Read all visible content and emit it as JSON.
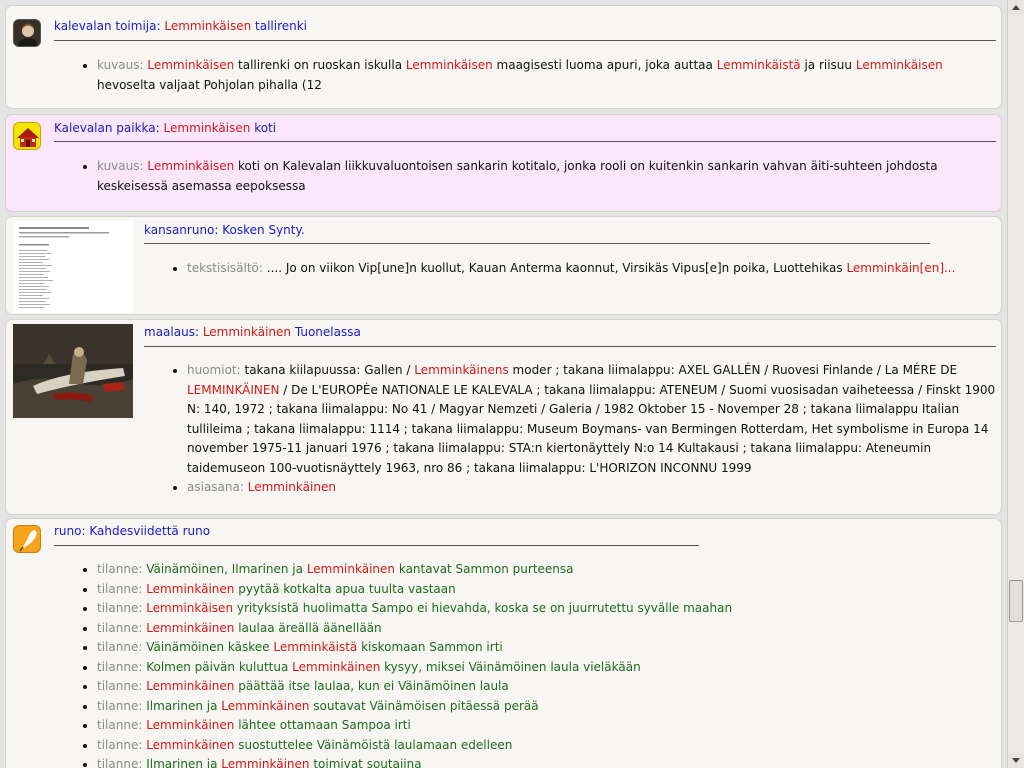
{
  "cards": [
    {
      "type_label": "kalevalan toimija:",
      "title_red": "Lemminkäisen",
      "title_blue": "tallirenki",
      "icon": "person-portrait-icon",
      "desc_label": "kuvaus:",
      "desc": [
        {
          "t": "Lemminkäisen",
          "c": "red"
        },
        {
          "t": " tallirenki on ruoskan iskulla ",
          "c": ""
        },
        {
          "t": "Lemminkäisen",
          "c": "red"
        },
        {
          "t": " maagisesti luoma apuri, joka auttaa ",
          "c": ""
        },
        {
          "t": "Lemminkäistä",
          "c": "red"
        },
        {
          "t": " ja riisuu ",
          "c": ""
        },
        {
          "t": "Lemminkäisen",
          "c": "red"
        },
        {
          "t": " hevoselta valjaat Pohjolan pihalla (12",
          "c": ""
        }
      ]
    },
    {
      "type_label": "Kalevalan paikka:",
      "title_red": "Lemminkäisen",
      "title_blue": "koti",
      "icon": "house-icon",
      "desc_label": "kuvaus:",
      "desc": [
        {
          "t": "Lemminkäisen",
          "c": "red"
        },
        {
          "t": " koti on Kalevalan liikkuvaluontoisen sankarin kotitalo, jonka rooli on kuitenkin sankarin vahvan äiti-suhteen johdosta keskeisessä asemassa eepoksessa",
          "c": ""
        }
      ]
    },
    {
      "type_label": "kansanruno:",
      "title_blue": "Kosken Synty.",
      "thumb": "document-page-thumbnail",
      "desc_label": "tekstisisältö:",
      "desc": [
        {
          "t": ".... Jo on viikon Vip[une]n kuollut, Kauan Anterma kaonnut, Virsikäs Vipus[e]n poika, Luottehikas ",
          "c": ""
        },
        {
          "t": "Lemminkäin[en]...",
          "c": "red"
        }
      ]
    },
    {
      "type_label": "maalaus:",
      "title_red": "Lemminkäinen",
      "title_blue": "Tuonelassa",
      "thumb": "painting-thumbnail",
      "notes_label": "huomiot:",
      "notes": [
        {
          "t": "takana kiilapuussa: Gallen / ",
          "c": ""
        },
        {
          "t": "Lemminkäinens",
          "c": "red"
        },
        {
          "t": " moder ; takana liimalappu: AXEL GALLÉN / Ruovesi Finlande / La MÉRE DE ",
          "c": ""
        },
        {
          "t": "LEMMINKÄINEN",
          "c": "red"
        },
        {
          "t": " / De L'EUROPÈe NATIONALE LE KALEVALA ; takana liimalappu: ATENEUM / Suomi vuosisadan vaiheteessa / Finskt 1900 N: 140, 1972 ; takana liimalappu: No 41 / Magyar Nemzeti / Galeria / 1982 Oktober 15 - Novemper 28 ; takana liimalappu Italian tullileima ; takana liimalappu: 1114 ; takana liimalappu: Museum Boymans- van Bermingen Rotterdam, Het symbolisme in Europa 14 november 1975-11 januari 1976 ; takana liimalappu: STA:n kiertonäyttely N:o 14 Kultakausi ; takana liimalappu: Ateneumin taidemuseon 100-vuotisnäyttely 1963, nro 86 ; takana liimalappu: L'HORIZON INCONNU 1999",
          "c": ""
        }
      ],
      "subject_label": "asiasana:",
      "subject": "Lemminkäinen"
    },
    {
      "type_label": "runo:",
      "title_blue": "Kahdesviidettä runo",
      "icon": "quill-pen-icon",
      "item_label": "tilanne:",
      "items": [
        [
          {
            "t": "Väinämöinen, Ilmarinen ja ",
            "c": "green"
          },
          {
            "t": "Lemminkäinen",
            "c": "red"
          },
          {
            "t": " kantavat Sammon purteensa",
            "c": "green"
          }
        ],
        [
          {
            "t": "Lemminkäinen",
            "c": "red"
          },
          {
            "t": " pyytää kotkalta apua tuulta vastaan",
            "c": "green"
          }
        ],
        [
          {
            "t": "Lemminkäisen",
            "c": "red"
          },
          {
            "t": " yrityksistä huolimatta Sampo ei hievahda, koska se on juurrutettu syvälle maahan",
            "c": "green"
          }
        ],
        [
          {
            "t": "Lemminkäinen",
            "c": "red"
          },
          {
            "t": " laulaa äreällä äänellään",
            "c": "green"
          }
        ],
        [
          {
            "t": "Väinämöinen käskee ",
            "c": "green"
          },
          {
            "t": "Lemminkäistä",
            "c": "red"
          },
          {
            "t": " kiskomaan Sammon irti",
            "c": "green"
          }
        ],
        [
          {
            "t": "Kolmen päivän kuluttua ",
            "c": "green"
          },
          {
            "t": "Lemminkäinen",
            "c": "red"
          },
          {
            "t": " kysyy, miksei Väinämöinen laula vieläkään",
            "c": "green"
          }
        ],
        [
          {
            "t": "Lemminkäinen",
            "c": "red"
          },
          {
            "t": " päättää itse laulaa, kun ei Väinämöinen laula",
            "c": "green"
          }
        ],
        [
          {
            "t": "Ilmarinen ja ",
            "c": "green"
          },
          {
            "t": "Lemminkäinen",
            "c": "red"
          },
          {
            "t": " soutavat Väinämöisen pitäessä perää",
            "c": "green"
          }
        ],
        [
          {
            "t": "Lemminkäinen",
            "c": "red"
          },
          {
            "t": " lähtee ottamaan Sampoa irti",
            "c": "green"
          }
        ],
        [
          {
            "t": "Lemminkäinen",
            "c": "red"
          },
          {
            "t": " suostuttelee Väinämöistä laulamaan edelleen",
            "c": "green"
          }
        ],
        [
          {
            "t": "Ilmarinen ja ",
            "c": "green"
          },
          {
            "t": "Lemminkäinen",
            "c": "red"
          },
          {
            "t": " toimivat soutajina",
            "c": "green"
          }
        ]
      ]
    }
  ],
  "colors": {
    "red": "#d41818",
    "blue": "#1b1bc4",
    "green": "#1f6a1f",
    "label": "#8a8a8a"
  }
}
